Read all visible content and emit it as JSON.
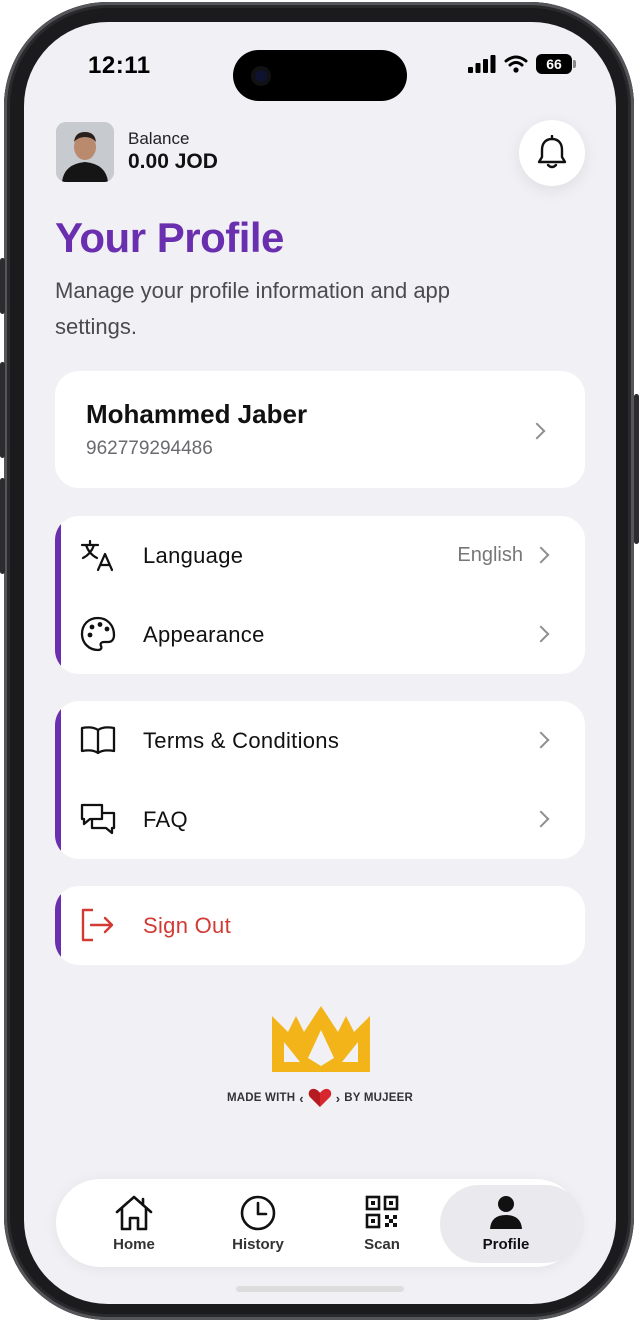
{
  "status_bar": {
    "time": "12:11",
    "battery": "66"
  },
  "header": {
    "balance_label": "Balance",
    "balance_value": "0.00 JOD"
  },
  "page": {
    "title": "Your Profile",
    "subtitle": "Manage your profile information and app settings."
  },
  "user": {
    "name": "Mohammed Jaber",
    "phone": "962779294486"
  },
  "settings": [
    {
      "label": "Language",
      "value": "English",
      "icon": "translate-icon"
    },
    {
      "label": "Appearance",
      "icon": "palette-icon"
    }
  ],
  "info": [
    {
      "label": "Terms & Conditions",
      "icon": "book-icon"
    },
    {
      "label": "FAQ",
      "icon": "chat-bubbles-icon"
    }
  ],
  "sign_out": {
    "label": "Sign Out",
    "icon": "sign-out-icon"
  },
  "footer": {
    "made_with": "MADE WITH",
    "by": "BY MUJEER"
  },
  "tabs": [
    {
      "label": "Home",
      "icon": "home-icon",
      "active": false
    },
    {
      "label": "History",
      "icon": "clock-icon",
      "active": false
    },
    {
      "label": "Scan",
      "icon": "qr-code-icon",
      "active": false
    },
    {
      "label": "Profile",
      "icon": "person-icon",
      "active": true
    }
  ],
  "colors": {
    "accent": "#6a2fae",
    "danger": "#d23a34",
    "background": "#f1f0f5",
    "logo_gold": "#f3b419"
  }
}
